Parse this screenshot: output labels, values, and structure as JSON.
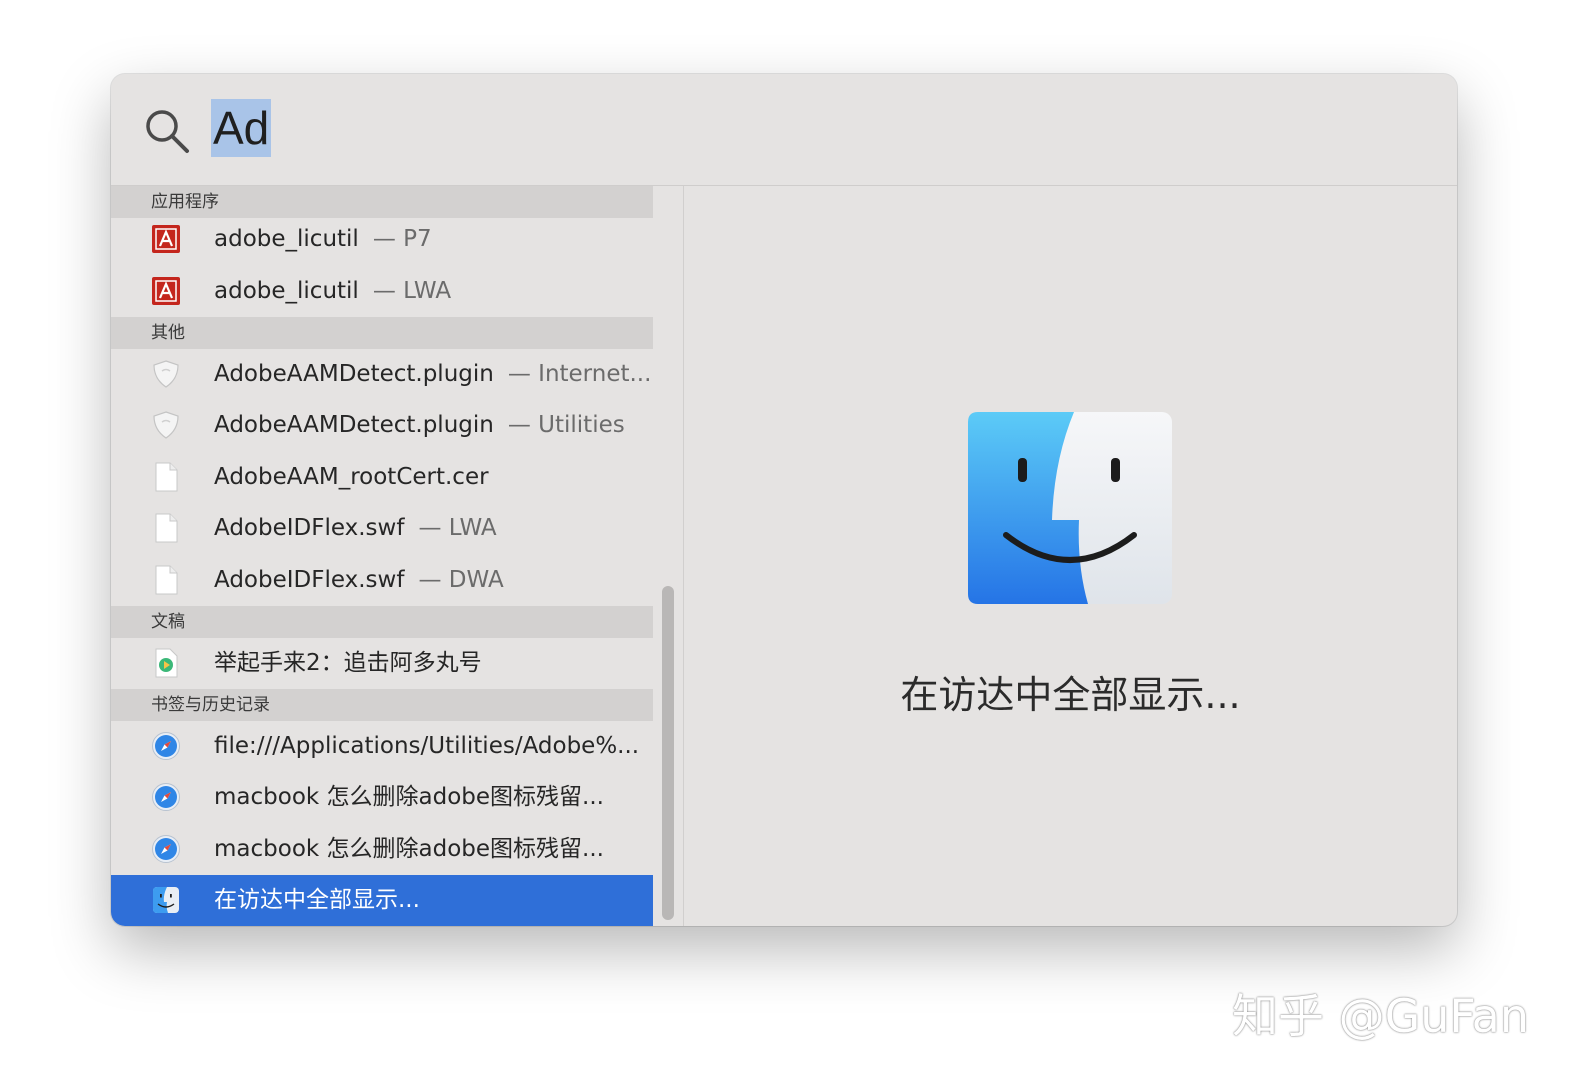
{
  "search": {
    "query": "Ad"
  },
  "sections": {
    "apps": {
      "header": "应用程序"
    },
    "other": {
      "header": "其他"
    },
    "docs": {
      "header": "文稿"
    },
    "bookmarks": {
      "header": "书签与历史记录"
    }
  },
  "results": {
    "adobe_licutil_p7": {
      "title": "adobe_licutil",
      "sub": "— P7",
      "icon": "adobe-icon"
    },
    "adobe_licutil_lwa": {
      "title": "adobe_licutil",
      "sub": "— LWA",
      "icon": "adobe-icon"
    },
    "aam_plugin_internet": {
      "title": "AdobeAAMDetect.plugin",
      "sub": "— Internet...",
      "icon": "plugin-icon"
    },
    "aam_plugin_utilities": {
      "title": "AdobeAAMDetect.plugin",
      "sub": "— Utilities",
      "icon": "plugin-icon"
    },
    "aam_rootcert": {
      "title": "AdobeAAM_rootCert.cer",
      "icon": "document-icon"
    },
    "idflex_lwa": {
      "title": "AdobeIDFlex.swf",
      "sub": "— LWA",
      "icon": "document-icon"
    },
    "idflex_dwa": {
      "title": "AdobeIDFlex.swf",
      "sub": "— DWA",
      "icon": "document-icon"
    },
    "doc_video": {
      "title": "举起手来2：追击阿多丸号",
      "icon": "video-icon"
    },
    "bookmark_file": {
      "title": "file:///Applications/Utilities/Adobe%...",
      "icon": "safari-icon"
    },
    "bookmark_macbook_1": {
      "title": "macbook 怎么删除adobe图标残留...",
      "icon": "safari-icon"
    },
    "bookmark_macbook_2": {
      "title": "macbook 怎么删除adobe图标残留...",
      "icon": "safari-icon"
    },
    "show_all_finder": {
      "title": "在访达中全部显示...",
      "icon": "finder-icon",
      "selected": true
    }
  },
  "preview": {
    "label": "在访达中全部显示...",
    "icon": "finder-icon"
  },
  "watermark": "知乎 @GuFan",
  "colors": {
    "selection": "#2f6fd8",
    "query_highlight": "#a9c4e8",
    "panel": "#e5e3e2"
  }
}
